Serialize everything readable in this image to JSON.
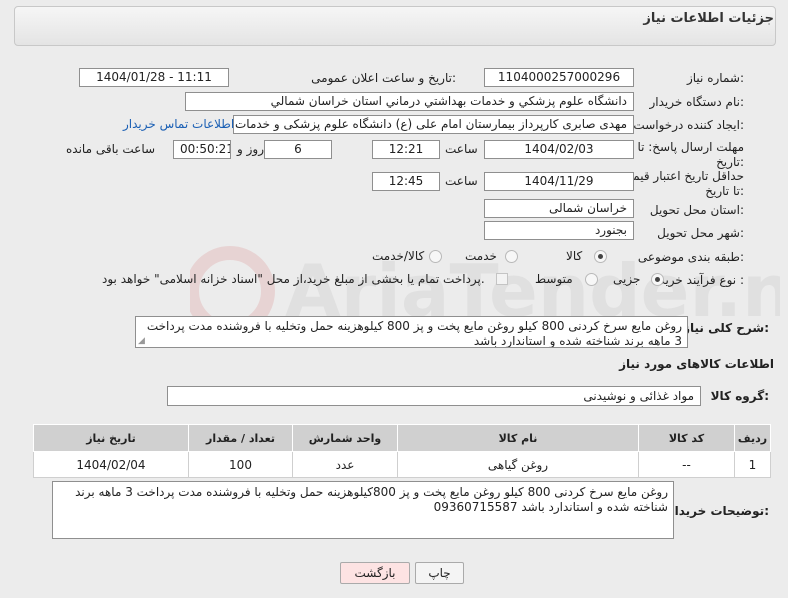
{
  "panel": {
    "title": "جزئیات اطلاعات نیاز"
  },
  "form": {
    "need_number_label": "شماره نیاز:",
    "need_number": "1104000257000296",
    "announce_label": "تاریخ و ساعت اعلان عمومی:",
    "announce_value": "1404/01/28 - 11:11",
    "buyer_org_label": "نام دستگاه خریدار:",
    "buyer_org": "دانشگاه علوم پزشکي و خدمات بهداشتي درماني استان خراسان شمالي",
    "creator_label": "ایجاد کننده درخواست:",
    "creator": "مهدی صابری کارپرداز بیمارستان امام علی (ع) دانشگاه علوم پزشکی و خدمات ب",
    "contact_link": "اطلاعات تماس خریدار",
    "deadline_label": "مهلت ارسال پاسخ: تا تاریخ:",
    "deadline_date": "1404/02/03",
    "time_label": "ساعت",
    "deadline_time": "12:21",
    "days_value": "6",
    "days_label": "روز و",
    "remaining_time": "00:50:21",
    "remaining_label": "ساعت باقی مانده",
    "price_validity_label": "حداقل تاریخ اعتبار قیمت: تا تاریخ:",
    "price_validity_date": "1404/11/29",
    "price_validity_time": "12:45",
    "province_label": "استان محل تحویل:",
    "province": "خراسان شمالی",
    "city_label": "شهر محل تحویل:",
    "city": "بجنورد",
    "category_label": "طبقه بندی موضوعی:",
    "category_options": [
      "کالا",
      "خدمت",
      "کالا/خدمت"
    ],
    "category_selected": "کالا",
    "process_label": "نوع فرآیند خرید :",
    "process_options": [
      "جزیی",
      "متوسط"
    ],
    "process_selected": "جزیی",
    "payment_note": "پرداخت تمام یا بخشی از مبلغ خرید،از محل \"اسناد خزانه اسلامی\" خواهد بود."
  },
  "description": {
    "label": "شرح کلی نیاز:",
    "text": "روغن مایع سرخ کردنی 800 کیلو روغن مایع پخت و پز 800 کیلوهزینه حمل وتخلیه با فروشنده مدت پرداخت 3 ماهه برند  شناخته شده و استاندارد باشد"
  },
  "goods": {
    "section_title": "اطلاعات کالاهای مورد نیاز",
    "group_label": "گروه کالا:",
    "group_value": "مواد غذائی و نوشیدنی",
    "columns": [
      "ردیف",
      "کد کالا",
      "نام کالا",
      "واحد شمارش",
      "تعداد / مقدار",
      "تاریخ نیاز"
    ],
    "rows": [
      [
        "1",
        "--",
        "روغن گیاهی",
        "عدد",
        "100",
        "1404/02/04"
      ]
    ]
  },
  "buyer_notes": {
    "label": "توضیحات خریدار:",
    "text": "روغن مایع سرخ کردنی 800 کیلو روغن مایع پخت و پز 800کیلوهزینه حمل وتخلیه با فروشنده مدت پرداخت 3 ماهه برند شناخته شده و استاندارد  باشد 09360715587"
  },
  "buttons": {
    "print": "چاپ",
    "back": "بازگشت"
  },
  "colors": {
    "back_button_bg": "#fde3e3",
    "link": "#1a5fb4",
    "table_header": "#d0d0d0"
  },
  "watermark_text": "AriaTender.neT"
}
